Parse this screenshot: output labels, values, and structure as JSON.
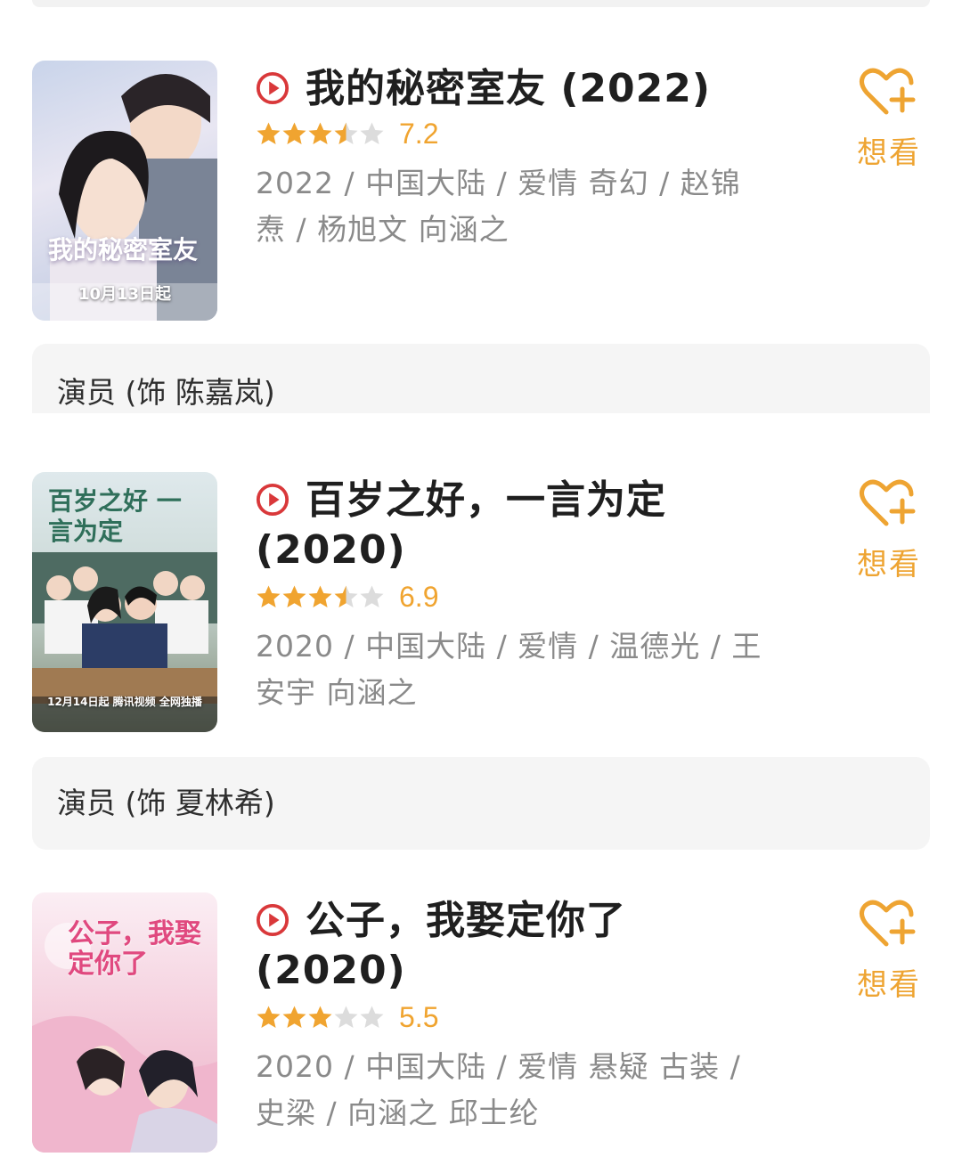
{
  "colors": {
    "accent_red": "#d9383a",
    "star_gold": "#f0a430",
    "want_orange": "#eea432",
    "meta_gray": "#8a8a8a"
  },
  "movies": [
    {
      "title": "我的秘密室友 (2022)",
      "rating": 3.5,
      "score": "7.2",
      "meta": "2022 / 中国大陆 / 爱情 奇幻 / 赵锦焘 / 杨旭文 向涵之",
      "want_label": "想看",
      "poster_title": "我的秘密室友",
      "poster_caption": "10月13日起",
      "role": "演员 (饰 陈嘉岚)"
    },
    {
      "title_line1": "百岁之好，一言为定",
      "title_line2": "(2020)",
      "rating": 3.5,
      "score": "6.9",
      "meta": "2020 / 中国大陆 / 爱情 / 温德光 / 王安宇 向涵之",
      "want_label": "想看",
      "poster_title": "百岁之好 一言为定",
      "poster_caption": "12月14日起 腾讯视频 全网独播",
      "role": "演员 (饰 夏林希)"
    },
    {
      "title_line1": "公子，我娶定你了",
      "title_line2": "(2020)",
      "rating": 3,
      "score": "5.5",
      "meta": "2020 / 中国大陆 / 爱情 悬疑 古装 / 史梁 / 向涵之 邱士纶",
      "want_label": "想看",
      "poster_title": "公子，我娶定你了"
    }
  ]
}
